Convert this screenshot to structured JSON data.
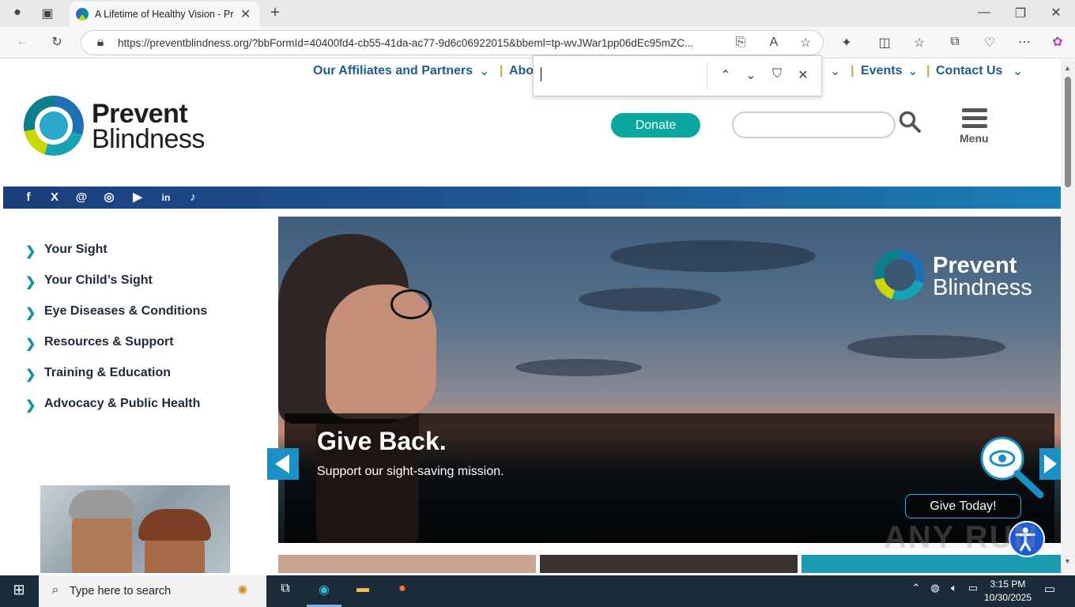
{
  "browser": {
    "tab_title": "A Lifetime of Healthy Vision - Prevent Blindness",
    "tab_close": "✕",
    "new_tab": "+",
    "url": "https://preventblindness.org/?bbFormId=40400fd4-cb55-41da-ac77-9d6c06922015&bbeml=tp-wvJWar1pp06dEc95mZC..."
  },
  "site": {
    "top_nav": [
      "Our Affiliates and Partners",
      "Abou",
      "Events",
      "Contact Us"
    ],
    "logo_line1": "Prevent",
    "logo_line2": "Blindness",
    "donate_label": "Donate",
    "search_placeholder": "",
    "menu_label": "Menu",
    "social": [
      {
        "name": "facebook-icon",
        "glyph": "f"
      },
      {
        "name": "x-icon",
        "glyph": "X"
      },
      {
        "name": "threads-icon",
        "glyph": "@"
      },
      {
        "name": "instagram-icon",
        "glyph": "◎"
      },
      {
        "name": "youtube-icon",
        "glyph": "▶"
      },
      {
        "name": "linkedin-icon",
        "glyph": "in"
      },
      {
        "name": "tiktok-icon",
        "glyph": "♪"
      }
    ],
    "side_nav": [
      "Your Sight",
      "Your Child’s Sight",
      "Eye Diseases & Conditions",
      "Resources & Support",
      "Training & Education",
      "Advocacy & Public Health"
    ],
    "hero": {
      "logo_line1": "Prevent",
      "logo_line2": "Blindness",
      "title": "Give Back.",
      "subtitle": "Support our sight-saving mission.",
      "button": "Give Today!"
    },
    "watermark": "ANY RUN"
  },
  "find_bar": {
    "query": ""
  },
  "taskbar": {
    "search_placeholder": "Type here to search",
    "time": "3:15 PM",
    "date": "10/30/2025"
  },
  "colors": {
    "nav_blue": "#1d5a8f",
    "accent_teal": "#0aa7a0",
    "side_chevron": "#1a8fa8",
    "social_bar_start": "#1b3e7c",
    "social_bar_end": "#1a7fb5",
    "slider_arrow": "#1a8fc8"
  }
}
